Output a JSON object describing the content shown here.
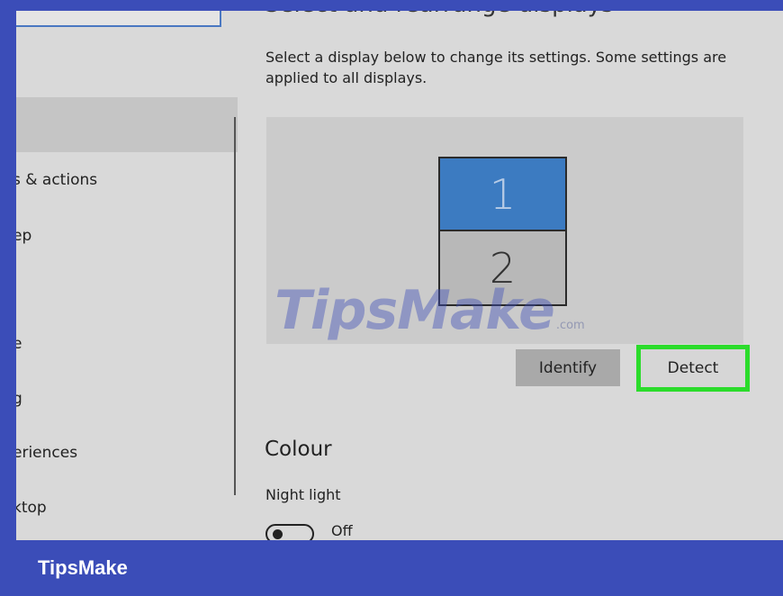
{
  "header": {
    "title": "Select and rearrange displays"
  },
  "sidebar": {
    "items": [
      {
        "label": "s & actions"
      },
      {
        "label": "ep"
      },
      {
        "label": "e"
      },
      {
        "label": "g"
      },
      {
        "label": "eriences"
      },
      {
        "label": "ktop"
      }
    ]
  },
  "main": {
    "description": "Select a display below to change its settings. Some settings are applied to all displays.",
    "displays": [
      {
        "number": "1",
        "selected": true
      },
      {
        "number": "2",
        "selected": false
      }
    ],
    "identify_label": "Identify",
    "detect_label": "Detect",
    "highlight_color": "#2bdc2b",
    "colour_heading": "Colour",
    "night_light": {
      "label": "Night light",
      "state": "Off"
    }
  },
  "watermark": {
    "text": "TipsMake",
    "suffix": ".com"
  },
  "footer": {
    "brand": "TipsMake",
    "color": "#3b4db8"
  }
}
